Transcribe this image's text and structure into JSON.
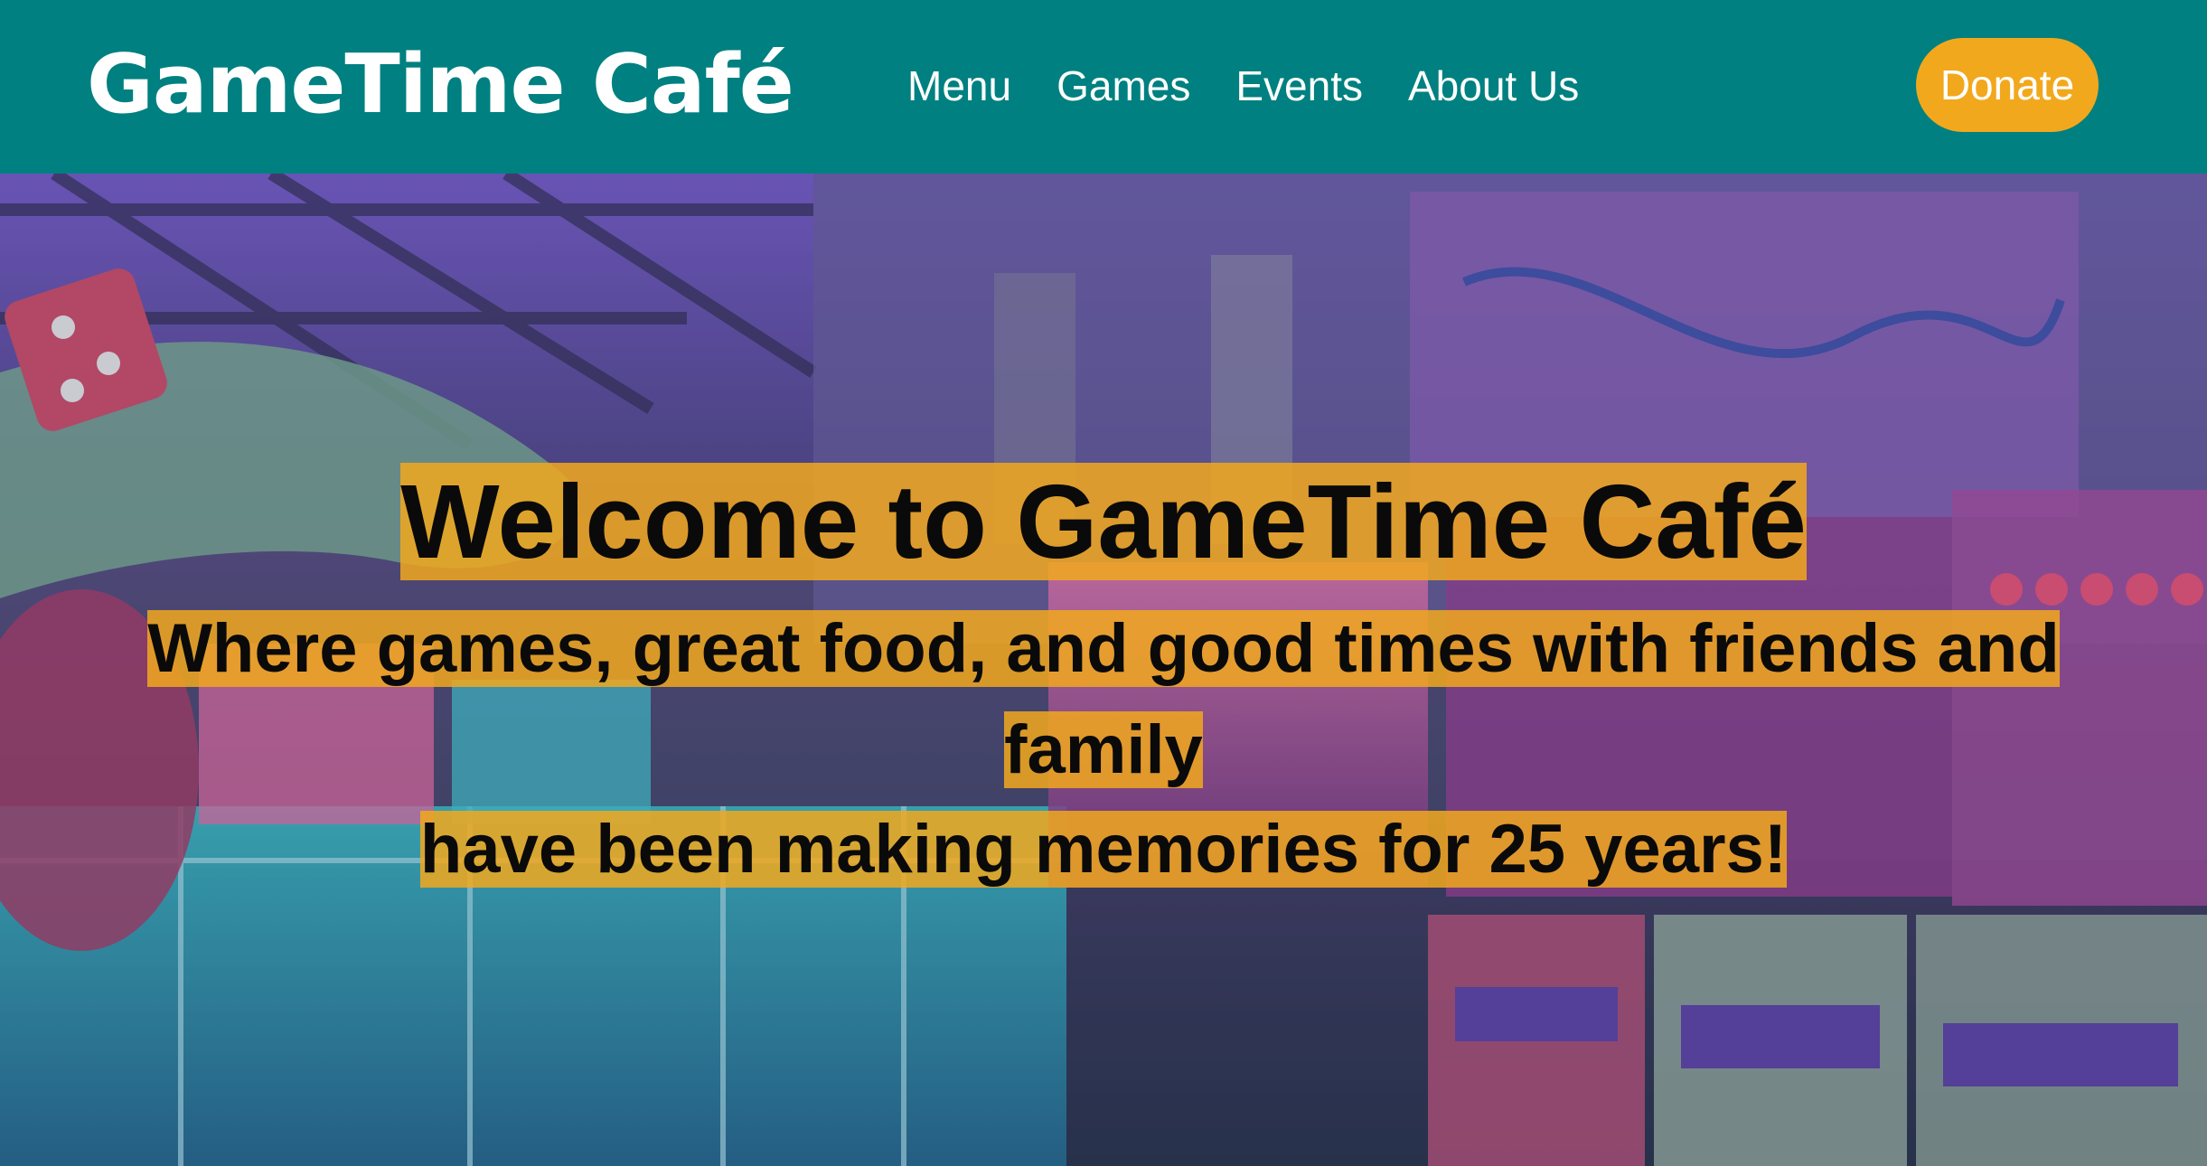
{
  "header": {
    "logo": "GameTime Café",
    "nav": {
      "menu": "Menu",
      "games": "Games",
      "events": "Events",
      "about": "About Us"
    },
    "donate_label": "Donate"
  },
  "hero": {
    "title": "Welcome to GameTime Café",
    "subtitle_line1": "Where games, great food, and good times with friends and family",
    "subtitle_line2": "have been making memories for 25 years!",
    "background_image": "arcade-interior-photo"
  },
  "colors": {
    "header_bg": "#008080",
    "accent": "#f2a81d",
    "text_dark": "#0a0a0a",
    "text_light": "#ffffff"
  }
}
